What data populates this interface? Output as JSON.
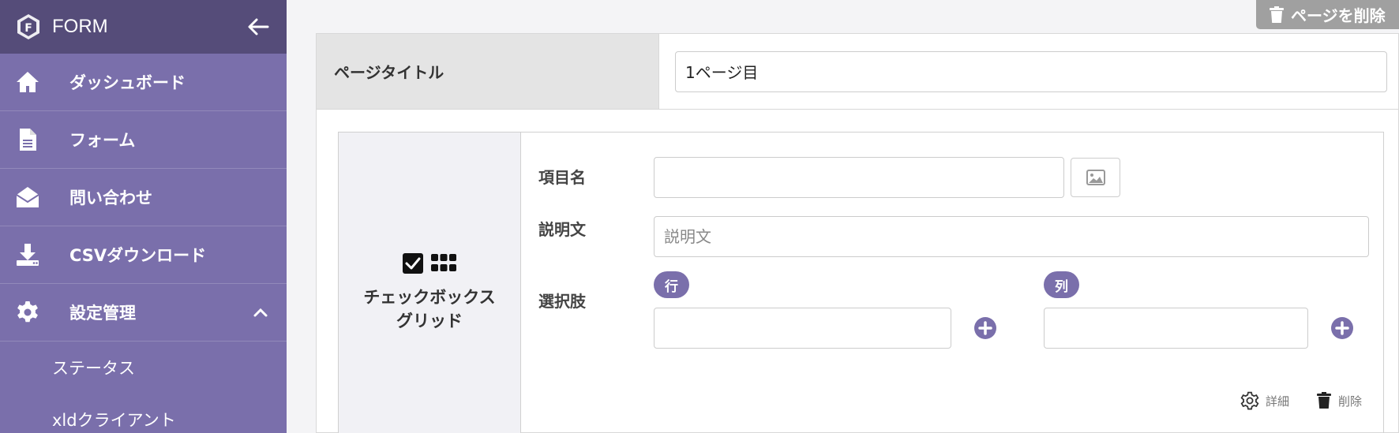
{
  "sidebar": {
    "app_title": "FORM",
    "items": [
      {
        "label": "ダッシュボード",
        "icon": "home-icon"
      },
      {
        "label": "フォーム",
        "icon": "document-icon"
      },
      {
        "label": "問い合わせ",
        "icon": "envelope-open-icon"
      },
      {
        "label": "CSVダウンロード",
        "icon": "download-icon"
      },
      {
        "label": "設定管理",
        "icon": "gear-icon"
      }
    ],
    "sub_items": [
      {
        "label": "ステータス"
      },
      {
        "label": "xldクライアント"
      }
    ]
  },
  "page_actions": {
    "delete_page_label": "ページを削除"
  },
  "page": {
    "title_label": "ページタイトル",
    "title_value": "1ページ目"
  },
  "question": {
    "type_label_line1": "チェックボックス",
    "type_label_line2": "グリッド",
    "item_name_label": "項目名",
    "item_name_value": "",
    "description_label": "説明文",
    "description_placeholder": "説明文",
    "choices_label": "選択肢",
    "row_pill": "行",
    "column_pill": "列",
    "row_value": "",
    "column_value": "",
    "detail_label": "詳細",
    "delete_label": "削除"
  },
  "colors": {
    "sidebar_bg": "#7a6fab",
    "sidebar_header_bg": "#554c79",
    "accent": "#7a6fab"
  }
}
